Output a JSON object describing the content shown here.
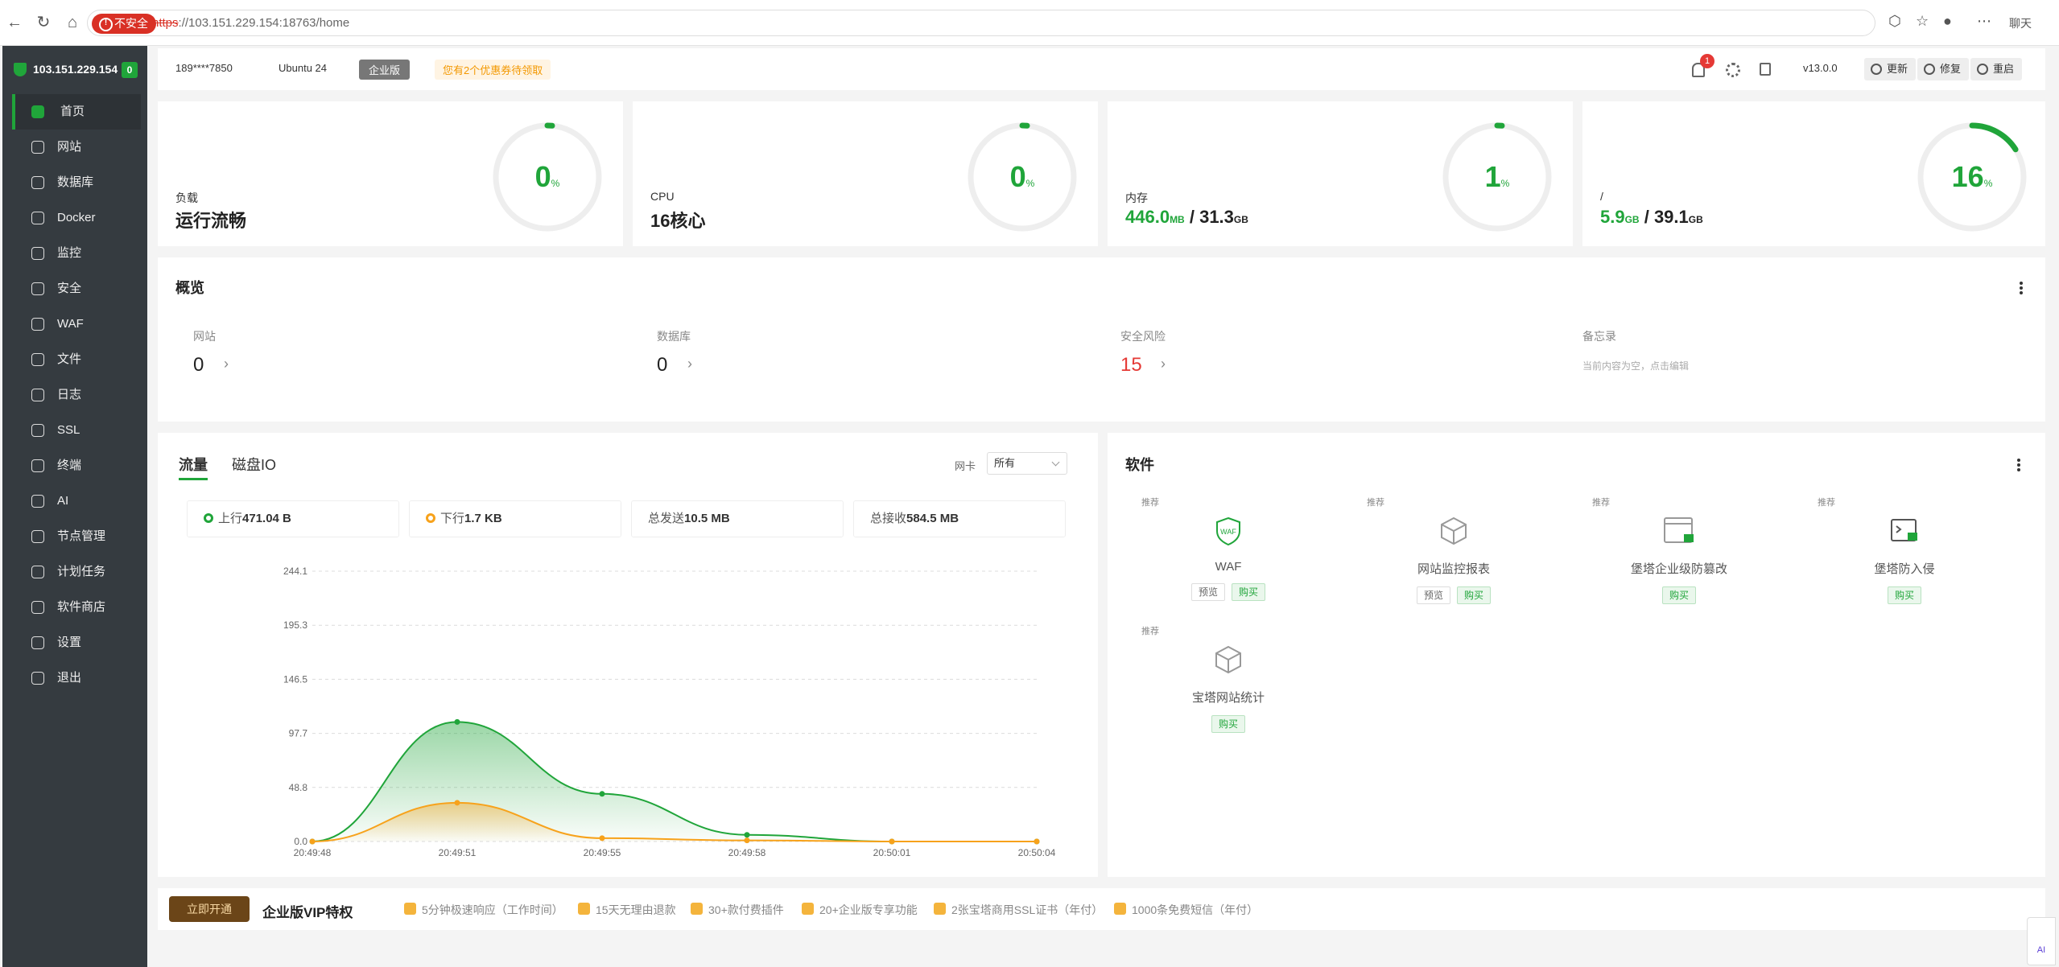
{
  "browser": {
    "security_label": "不安全",
    "url_scheme": "https",
    "url_rest": "://103.151.229.154:18763/home",
    "chat_label": "聊天"
  },
  "sidebar": {
    "server_ip": "103.151.229.154",
    "server_count": "0",
    "items": [
      {
        "label": "首页",
        "active": true
      },
      {
        "label": "网站"
      },
      {
        "label": "数据库"
      },
      {
        "label": "Docker"
      },
      {
        "label": "监控"
      },
      {
        "label": "安全"
      },
      {
        "label": "WAF"
      },
      {
        "label": "文件"
      },
      {
        "label": "日志"
      },
      {
        "label": "SSL"
      },
      {
        "label": "终端"
      },
      {
        "label": "AI"
      },
      {
        "label": "节点管理"
      },
      {
        "label": "计划任务"
      },
      {
        "label": "软件商店"
      },
      {
        "label": "设置"
      },
      {
        "label": "退出"
      }
    ]
  },
  "topbar": {
    "user": "189****7850",
    "os": "Ubuntu 24",
    "edition": "企业版",
    "coupon": "您有2个优惠券待领取",
    "notif_count": "1",
    "version": "v13.0.0",
    "update": "更新",
    "repair": "修复",
    "restart": "重启"
  },
  "stats": [
    {
      "label": "负载",
      "value": "运行流畅",
      "percent": "0",
      "pct": 0
    },
    {
      "label": "CPU",
      "value": "16核心",
      "percent": "0",
      "pct": 0
    },
    {
      "label": "内存",
      "used": "446.0",
      "used_unit": "MB",
      "total": "31.3",
      "total_unit": "GB",
      "percent": "1",
      "pct": 1
    },
    {
      "label": "/",
      "used": "5.9",
      "used_unit": "GB",
      "total": "39.1",
      "total_unit": "GB",
      "percent": "16",
      "pct": 16
    }
  ],
  "overview": {
    "title": "概览",
    "items": [
      {
        "label": "网站",
        "value": "0"
      },
      {
        "label": "数据库",
        "value": "0"
      },
      {
        "label": "安全风险",
        "value": "15"
      }
    ],
    "memo_label": "备忘录",
    "memo_text": "当前内容为空，点击编辑"
  },
  "traffic": {
    "tab1": "流量",
    "tab2": "磁盘IO",
    "nic_label": "网卡",
    "nic_value": "所有",
    "up_label": "上行",
    "up_value": "471.04 B",
    "down_label": "下行",
    "down_value": "1.7 KB",
    "sent_label": "总发送",
    "sent_value": "10.5 MB",
    "recv_label": "总接收",
    "recv_value": "584.5 MB"
  },
  "chart_data": {
    "type": "area",
    "x": [
      "20:49:48",
      "20:49:51",
      "20:49:55",
      "20:49:58",
      "20:50:01",
      "20:50:04"
    ],
    "y_ticks": [
      "244.1",
      "195.3",
      "146.5",
      "97.7",
      "48.8",
      "0.0"
    ],
    "ylim": [
      0,
      244.1
    ],
    "series": [
      {
        "name": "上行",
        "color": "#20a53a",
        "values": [
          0,
          108,
          43,
          6,
          0,
          0
        ]
      },
      {
        "name": "下行",
        "color": "#f7a21b",
        "values": [
          0,
          35,
          3,
          1,
          0,
          0
        ]
      }
    ]
  },
  "software": {
    "title": "软件",
    "rec": "推荐",
    "items": [
      {
        "name": "WAF",
        "preview": "预览",
        "buy": "购买"
      },
      {
        "name": "网站监控报表",
        "preview": "预览",
        "buy": "购买"
      },
      {
        "name": "堡塔企业级防篡改",
        "buy": "购买"
      },
      {
        "name": "堡塔防入侵",
        "buy": "购买"
      },
      {
        "name": "宝塔网站统计",
        "buy": "购买"
      }
    ]
  },
  "vip": {
    "button": "立即开通",
    "title": "企业版VIP特权",
    "items": [
      "5分钟极速响应（工作时间）",
      "15天无理由退款",
      "30+款付费插件",
      "20+企业版专享功能",
      "2张宝塔商用SSL证书（年付）",
      "1000条免费短信（年付）"
    ]
  },
  "ai_label": "AI"
}
